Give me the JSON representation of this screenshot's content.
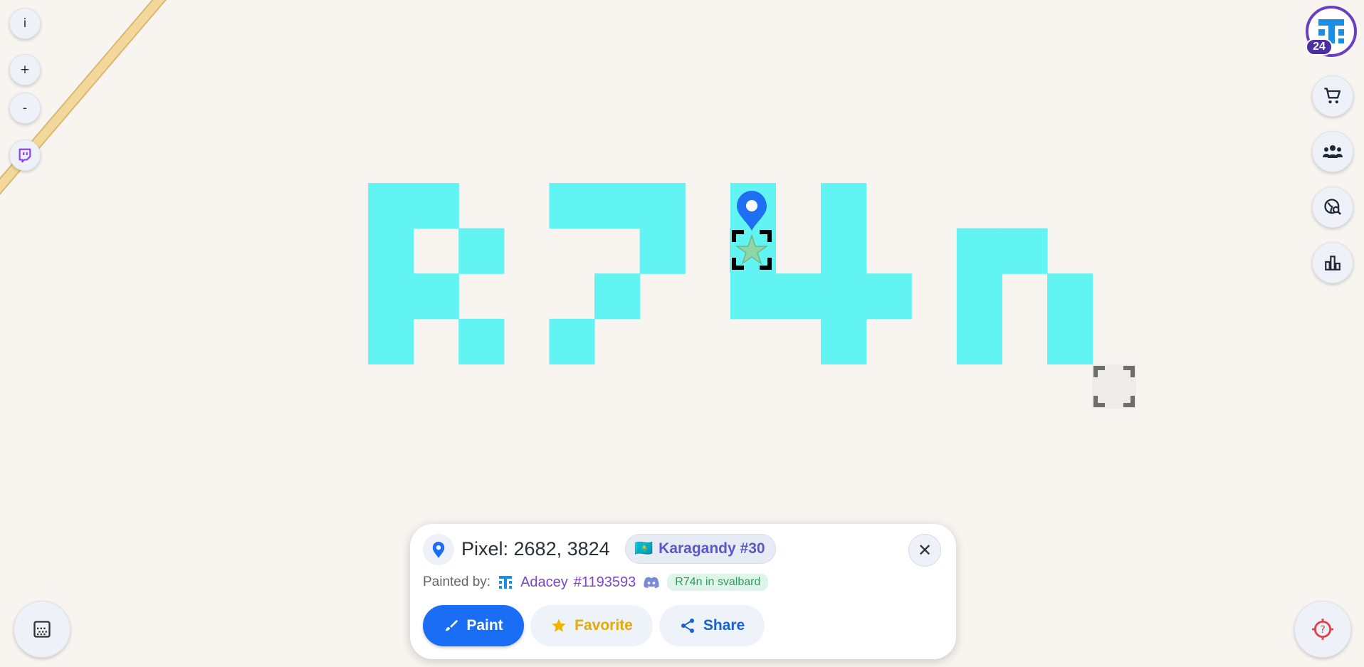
{
  "map": {
    "artwork_color": "#62f4f2",
    "road_color": "#f4d79a",
    "background_color": "#f8f4f0"
  },
  "left_controls": {
    "info_label": "i",
    "zoom_in_label": "+",
    "zoom_out_label": "-",
    "twitch_icon": "twitch-icon"
  },
  "user": {
    "level": "24",
    "avatar_icon": "pixel-avatar-icon"
  },
  "right_controls": [
    {
      "name": "store-button",
      "icon": "cart-icon"
    },
    {
      "name": "alliance-button",
      "icon": "group-icon"
    },
    {
      "name": "explore-button",
      "icon": "globe-search-icon"
    },
    {
      "name": "leaderboard-button",
      "icon": "bar-chart-icon"
    }
  ],
  "pixel_panel": {
    "title": "Pixel: 2682, 3824",
    "region": {
      "flag": "🇰🇿",
      "label": "Karagandy #30"
    },
    "painted_by_label": "Painted by:",
    "user_name": "Adacey",
    "user_id": "#1193593",
    "alliance_tag": "R74n in svalbard",
    "buttons": {
      "paint": "Paint",
      "favorite": "Favorite",
      "share": "Share"
    },
    "accent_color": "#1a6df5"
  }
}
